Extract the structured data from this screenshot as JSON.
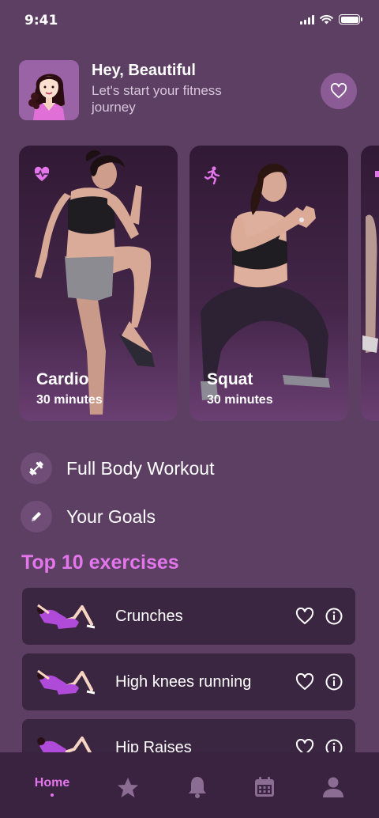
{
  "status_bar": {
    "time": "9:41"
  },
  "header": {
    "greeting": "Hey, Beautiful",
    "subtitle": "Let's start your fitness journey"
  },
  "workout_cards": [
    {
      "title": "Cardio",
      "duration": "30 minutes",
      "icon": "heart-pulse-icon"
    },
    {
      "title": "Squat",
      "duration": "30 minutes",
      "icon": "running-icon"
    }
  ],
  "menu": [
    {
      "label": "Full Body Workout",
      "icon": "dumbbell-icon"
    },
    {
      "label": "Your Goals",
      "icon": "pencil-icon"
    }
  ],
  "exercises_section": {
    "title": "Top 10 exercises",
    "items": [
      {
        "label": "Crunches"
      },
      {
        "label": "High knees running"
      },
      {
        "label": "Hip Raises"
      }
    ]
  },
  "tabbar": {
    "home_label": "Home",
    "active_color": "#e476ec",
    "inactive_color": "#8b6c92"
  },
  "colors": {
    "background": "#5c3f63",
    "accent": "#e476ec",
    "card_dark": "#3b2642"
  }
}
